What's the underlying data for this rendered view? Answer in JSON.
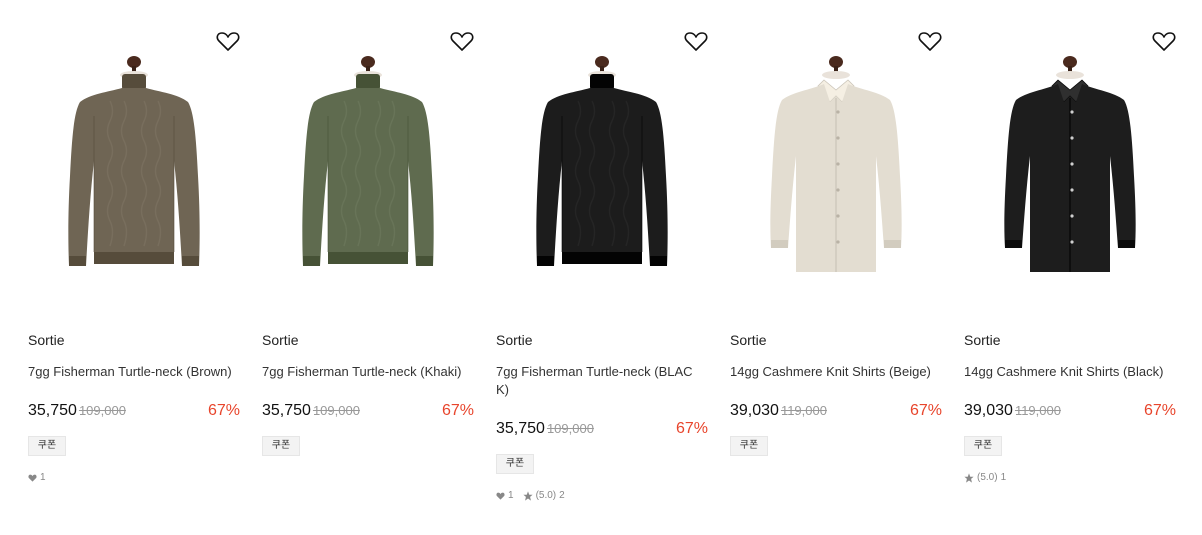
{
  "colors": {
    "discount": "#e8452c",
    "badge_bg": "#f3f3f3"
  },
  "products": [
    {
      "brand": "Sortie",
      "name": "7gg Fisherman Turtle-neck (Brown)",
      "price": "35,750",
      "original_price": "109,000",
      "discount": "67%",
      "badge": "쿠폰",
      "likes": "1",
      "rating": "",
      "reviews": "",
      "garment": "turtleneck",
      "color": "#6f6554"
    },
    {
      "brand": "Sortie",
      "name": "7gg Fisherman Turtle-neck (Khaki)",
      "price": "35,750",
      "original_price": "109,000",
      "discount": "67%",
      "badge": "쿠폰",
      "likes": "",
      "rating": "",
      "reviews": "",
      "garment": "turtleneck",
      "color": "#5f6b4f"
    },
    {
      "brand": "Sortie",
      "name": "7gg Fisherman Turtle-neck (BLACK)",
      "price": "35,750",
      "original_price": "109,000",
      "discount": "67%",
      "badge": "쿠폰",
      "likes": "1",
      "rating": "(5.0)",
      "reviews": "2",
      "garment": "turtleneck",
      "color": "#1c1c1c"
    },
    {
      "brand": "Sortie",
      "name": "14gg Cashmere Knit Shirts (Beige)",
      "price": "39,030",
      "original_price": "119,000",
      "discount": "67%",
      "badge": "쿠폰",
      "likes": "",
      "rating": "",
      "reviews": "",
      "garment": "shirt",
      "color": "#e3ddd1"
    },
    {
      "brand": "Sortie",
      "name": "14gg Cashmere Knit Shirts (Black)",
      "price": "39,030",
      "original_price": "119,000",
      "discount": "67%",
      "badge": "쿠폰",
      "likes": "",
      "rating": "(5.0)",
      "reviews": "1",
      "garment": "shirt",
      "color": "#1d1d1d"
    }
  ]
}
